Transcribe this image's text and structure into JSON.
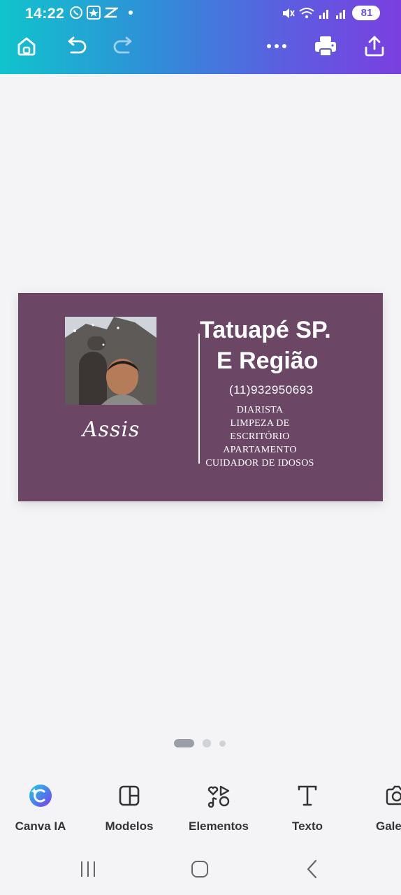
{
  "status_bar": {
    "time": "14:22",
    "battery": "81"
  },
  "toolbar": {
    "home_icon": "home-icon",
    "undo_icon": "undo-icon",
    "redo_icon": "redo-icon",
    "more_icon": "more-dots-icon",
    "print_icon": "print-icon",
    "share_icon": "share-icon"
  },
  "design": {
    "background_color": "#6b4665",
    "signature": "Assis",
    "headline_line1": "Tatuapé SP.",
    "headline_line2": "E Região",
    "phone": "(11)932950693",
    "services": [
      "DIARISTA",
      "LIMPEZA DE",
      "ESCRITÓRIO",
      "APARTAMENTO",
      "CUIDADOR DE IDOSOS"
    ]
  },
  "pager": {
    "pages": 3,
    "active": 1
  },
  "tools": [
    {
      "label": "Canva IA",
      "icon": "canva-ai-icon"
    },
    {
      "label": "Modelos",
      "icon": "templates-icon"
    },
    {
      "label": "Elementos",
      "icon": "elements-icon"
    },
    {
      "label": "Texto",
      "icon": "text-icon"
    },
    {
      "label": "Gale",
      "icon": "camera-icon"
    }
  ],
  "colors": {
    "accent_gradient_start": "#10c4cc",
    "accent_gradient_end": "#7a3fe0"
  }
}
